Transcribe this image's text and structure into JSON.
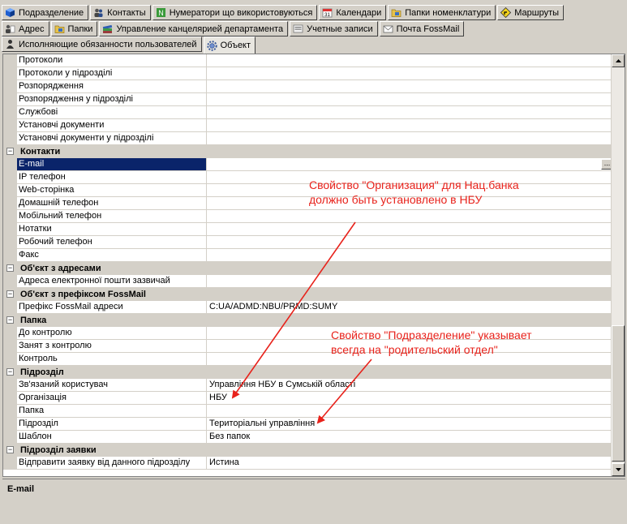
{
  "tabs": {
    "row1": [
      {
        "label": "Подразделение",
        "icon": "cube-icon"
      },
      {
        "label": "Контакты",
        "icon": "people-icon"
      },
      {
        "label": "Нумератори що використовуються",
        "icon": "numbering-icon"
      },
      {
        "label": "Календари",
        "icon": "calendar-icon"
      },
      {
        "label": "Папки номенклатури",
        "icon": "folder-icon"
      },
      {
        "label": "Маршруты",
        "icon": "route-sign-icon"
      }
    ],
    "row2": [
      {
        "label": "Адрес",
        "icon": "address-icon"
      },
      {
        "label": "Папки",
        "icon": "folder-icon"
      },
      {
        "label": "Управление канцелярией департамента",
        "icon": "books-icon"
      },
      {
        "label": "Учетные записи",
        "icon": "accounts-icon"
      },
      {
        "label": "Почта FossMail",
        "icon": "mail-icon"
      }
    ],
    "row3": [
      {
        "label": "Исполняющие обязанности пользователей",
        "icon": "person-icon"
      },
      {
        "label": "Объект",
        "icon": "gear-icon",
        "active": true
      }
    ]
  },
  "grid": [
    {
      "type": "prop",
      "name": "Протоколи",
      "value": ""
    },
    {
      "type": "prop",
      "name": "Протоколи у підрозділі",
      "value": ""
    },
    {
      "type": "prop",
      "name": "Розпорядження",
      "value": ""
    },
    {
      "type": "prop",
      "name": "Розпорядження у підрозділі",
      "value": ""
    },
    {
      "type": "prop",
      "name": "Службові",
      "value": ""
    },
    {
      "type": "prop",
      "name": "Установчі документи",
      "value": ""
    },
    {
      "type": "prop",
      "name": "Установчі документи у підрозділі",
      "value": ""
    },
    {
      "type": "cat",
      "name": "Контакти"
    },
    {
      "type": "prop",
      "name": "E-mail",
      "value": "",
      "selected": true,
      "ellipsis": "..."
    },
    {
      "type": "prop",
      "name": "IP телефон",
      "value": ""
    },
    {
      "type": "prop",
      "name": "Web-сторінка",
      "value": ""
    },
    {
      "type": "prop",
      "name": "Домашній телефон",
      "value": ""
    },
    {
      "type": "prop",
      "name": "Мобільний телефон",
      "value": ""
    },
    {
      "type": "prop",
      "name": "Нотатки",
      "value": ""
    },
    {
      "type": "prop",
      "name": "Робочий телефон",
      "value": ""
    },
    {
      "type": "prop",
      "name": "Факс",
      "value": ""
    },
    {
      "type": "cat",
      "name": "Об'єкт з адресами"
    },
    {
      "type": "prop",
      "name": "Адреса електронної пошти зазвичай",
      "value": ""
    },
    {
      "type": "cat",
      "name": "Об'єкт з префіксом FossMail"
    },
    {
      "type": "prop",
      "name": "Префікс FossMail адреси",
      "value": "C:UA/ADMD:NBU/PRMD:SUMY"
    },
    {
      "type": "cat",
      "name": "Папка"
    },
    {
      "type": "prop",
      "name": "До контролю",
      "value": ""
    },
    {
      "type": "prop",
      "name": "Занят з контролю",
      "value": ""
    },
    {
      "type": "prop",
      "name": "Контроль",
      "value": ""
    },
    {
      "type": "cat",
      "name": "Підрозділ"
    },
    {
      "type": "prop",
      "name": "Зв'язаний користувач",
      "value": "Управління НБУ в Сумській області"
    },
    {
      "type": "prop",
      "name": "Організація",
      "value": "НБУ"
    },
    {
      "type": "prop",
      "name": "Папка",
      "value": ""
    },
    {
      "type": "prop",
      "name": "Підрозділ",
      "value": "Територіальні управління"
    },
    {
      "type": "prop",
      "name": "Шаблон",
      "value": "Без папок"
    },
    {
      "type": "cat",
      "name": "Підрозділ заявки"
    },
    {
      "type": "prop",
      "name": "Відправити заявку від данного підрозділу",
      "value": "Истина"
    }
  ],
  "description": {
    "title": "E-mail"
  },
  "annotations": {
    "note1_line1": "Свойство \"Организация\" для Нац.банка",
    "note1_line2": "должно быть установлено в НБУ",
    "note2_line1": "Свойство \"Подразделение\" указывает",
    "note2_line2": "всегда на \"родительский отдел\"",
    "color": "#e8221b"
  },
  "colors": {
    "selection": "#0a246a",
    "window": "#d4d0c8"
  }
}
